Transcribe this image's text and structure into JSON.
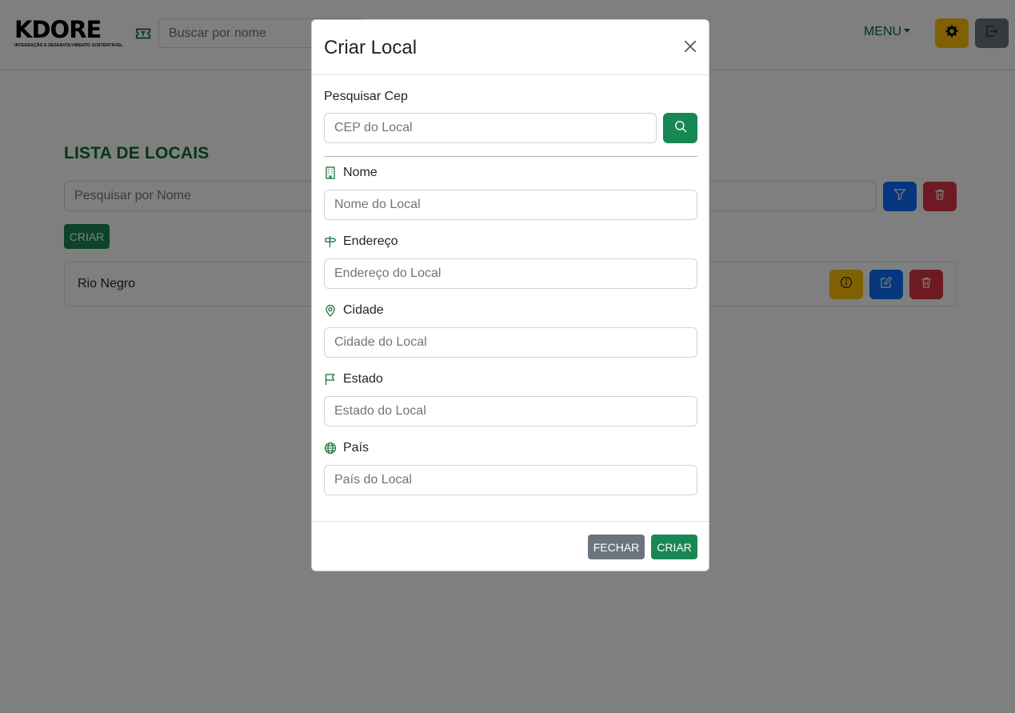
{
  "navbar": {
    "logo_text": "KDORE",
    "logo_subtitle": "INTEGRAÇÃO E DESENVOLVIMENTO SUSTENTÁVEL",
    "search_placeholder": "Buscar por nome",
    "menu_label": "MENU",
    "icons": {
      "ticket": "ticket-icon",
      "settings": "gear-icon",
      "logout": "logout-icon"
    }
  },
  "page": {
    "title": "LISTA DE LOCAIS",
    "search_placeholder": "Pesquisar por Nome",
    "create_label": "CRIAR",
    "items": [
      {
        "name": "Rio Negro"
      }
    ]
  },
  "modal": {
    "title": "Criar Local",
    "cep": {
      "label": "Pesquisar Cep",
      "placeholder": "CEP do Local"
    },
    "fields": [
      {
        "label": "Nome",
        "placeholder": "Nome do Local",
        "icon": "building-icon"
      },
      {
        "label": "Endereço",
        "placeholder": "Endereço do Local",
        "icon": "signpost-icon"
      },
      {
        "label": "Cidade",
        "placeholder": "Cidade do Local",
        "icon": "map-pin-icon"
      },
      {
        "label": "Estado",
        "placeholder": "Estado do Local",
        "icon": "flag-icon"
      },
      {
        "label": "País",
        "placeholder": "País do Local",
        "icon": "globe-icon"
      }
    ],
    "close_label": "FECHAR",
    "submit_label": "CRIAR"
  },
  "colors": {
    "brand_green": "#0b6b2e",
    "success": "#198754",
    "primary": "#0d6efd",
    "danger": "#dc3545",
    "warning": "#ffc107",
    "secondary": "#6c757d"
  }
}
